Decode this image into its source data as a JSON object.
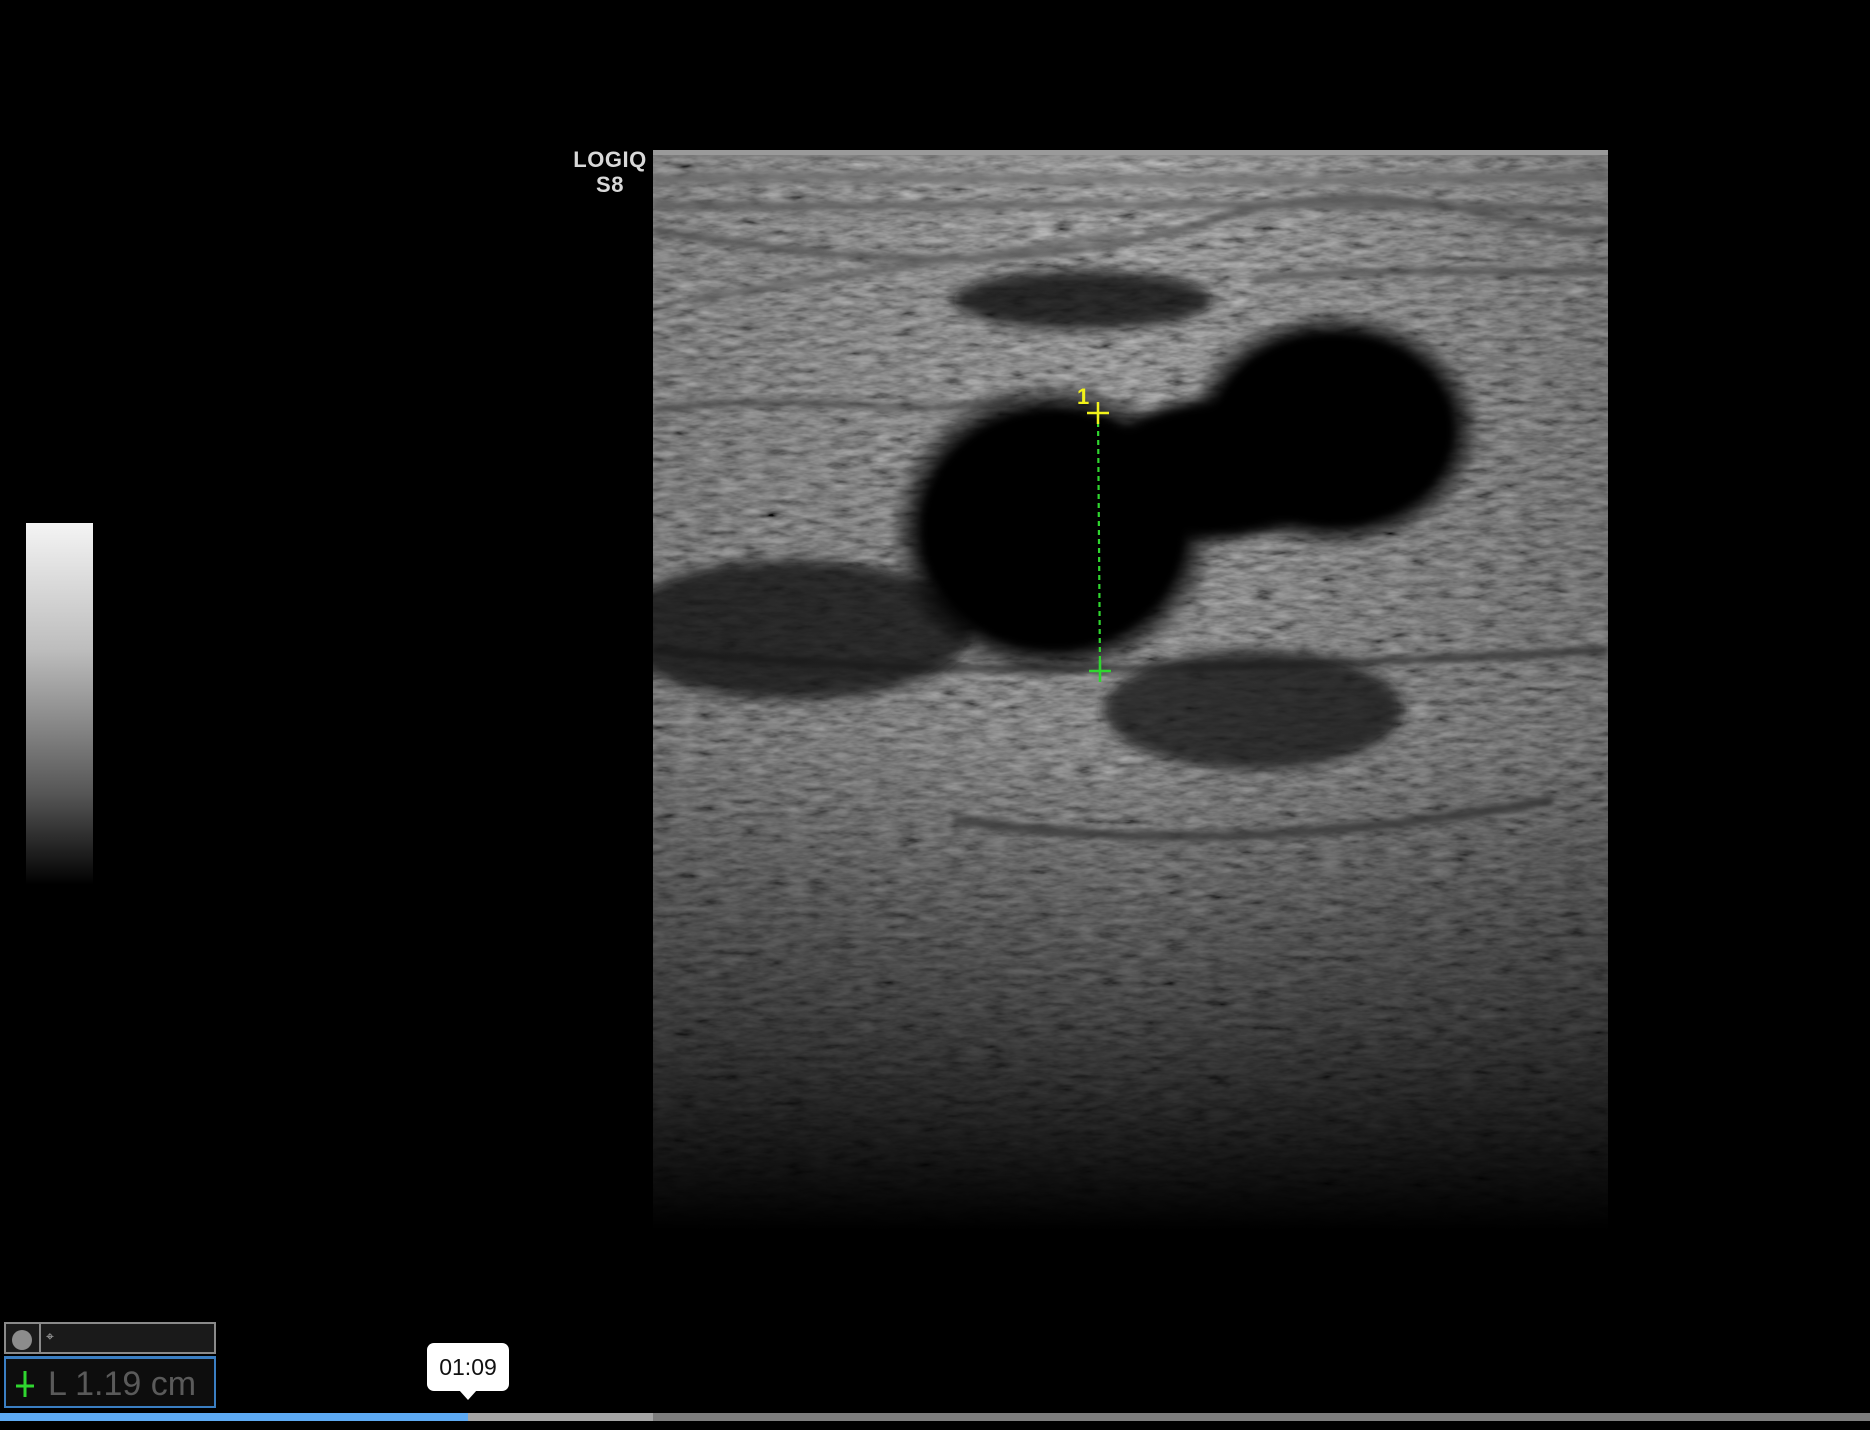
{
  "device": {
    "brand": "LOGIQ",
    "model": "S8"
  },
  "measurement": {
    "marker_number": "1",
    "label": "L",
    "value": "1.19 cm"
  },
  "playback": {
    "current_time": "01:09",
    "progress_fraction": 0.25
  },
  "colors": {
    "caliper_start": "#f2f21a",
    "caliper_end": "#2fd62f",
    "progress": "#5da9f2",
    "panel_active_border": "#3a7ec2"
  },
  "icons": {
    "panel_mode": "record-dot-icon",
    "panel_tool": "cursor-icon",
    "measurement_marker": "caliper-cross-icon"
  }
}
